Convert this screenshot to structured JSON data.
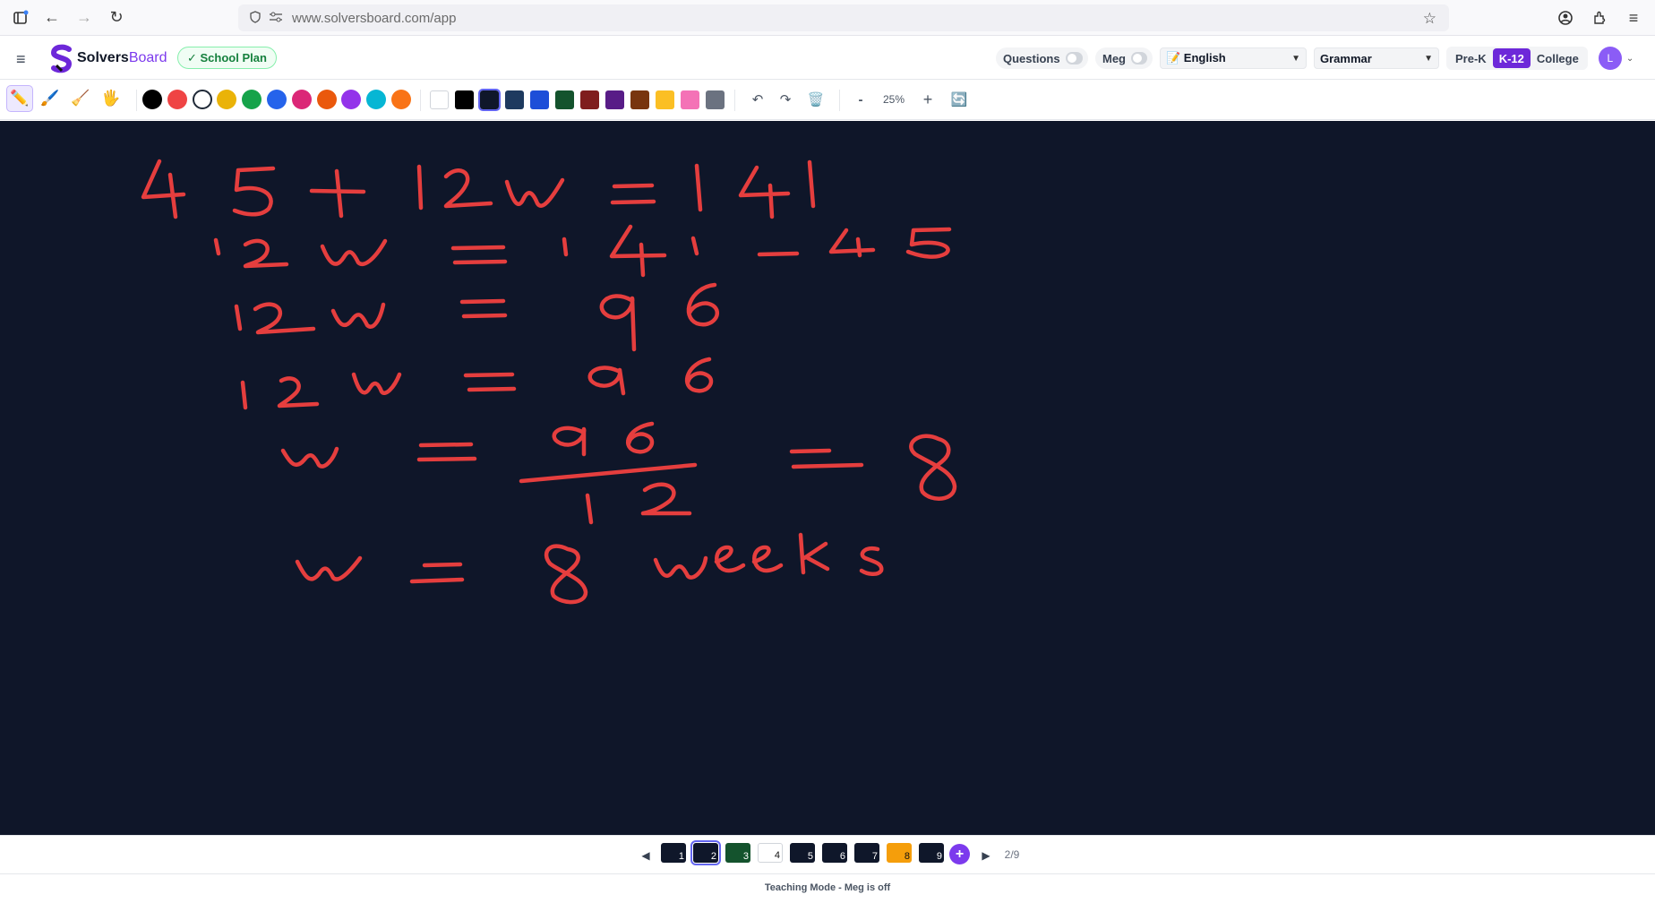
{
  "browser": {
    "url": "www.solversboard.com/app"
  },
  "header": {
    "brand_main": "Solvers",
    "brand_accent": "Board",
    "plan_badge": "✓ School Plan",
    "questions_label": "Questions",
    "meg_label": "Meg",
    "language_selected": "📝 English",
    "subject_selected": "Grammar",
    "levels": [
      "Pre-K",
      "K-12",
      "College"
    ],
    "active_level": "K-12",
    "avatar_initial": "L"
  },
  "toolbar": {
    "tools": [
      "pencil-icon",
      "brush-icon",
      "eraser-icon",
      "hand-icon"
    ],
    "pen_colors": [
      "#000000",
      "#ef4444",
      "#ffffff",
      "#eab308",
      "#16a34a",
      "#2563eb",
      "#db2777",
      "#ea580c",
      "#9333ea",
      "#06b6d4",
      "#f97316"
    ],
    "bg_colors": [
      "#ffffff",
      "#000000",
      "#0f172a",
      "#1e3a5f",
      "#1d4ed8",
      "#14532d",
      "#7f1d1d",
      "#581c87",
      "#78350f",
      "#fbbf24",
      "#f472b6",
      "#6b7280"
    ],
    "zoom_out": "-",
    "zoom_level": "25%",
    "zoom_in": "+"
  },
  "canvas": {
    "stroke_color": "#e53e3e",
    "background": "#0f1629",
    "lines": [
      "45 + 12w = 141",
      "12w = 141 − 45",
      "12w = 96",
      "12w = 96",
      "w = 96/12 = 8",
      "w = 8 weeks"
    ]
  },
  "pages": {
    "prev": "◀",
    "next": "▶",
    "add": "+",
    "items": [
      {
        "label": "1",
        "color": "#0f172a"
      },
      {
        "label": "2",
        "color": "#0f172a"
      },
      {
        "label": "3",
        "color": "#14532d"
      },
      {
        "label": "4",
        "color": "#ffffff"
      },
      {
        "label": "5",
        "color": "#0f172a"
      },
      {
        "label": "6",
        "color": "#0f172a"
      },
      {
        "label": "7",
        "color": "#0f172a"
      },
      {
        "label": "8",
        "color": "#f59e0b"
      },
      {
        "label": "9",
        "color": "#0f172a"
      }
    ],
    "active": "2",
    "counter": "2/9"
  },
  "footer": {
    "status": "Teaching Mode - Meg is off"
  }
}
